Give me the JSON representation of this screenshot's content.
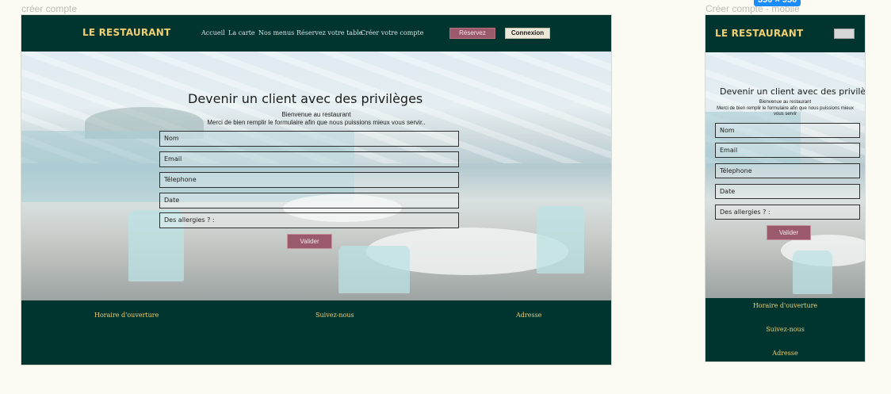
{
  "desktop": {
    "frame_label": "créer compte",
    "brand": "LE RESTAURANT",
    "nav": [
      "Accueil",
      "La carte",
      "Nos menus",
      "Réservez votre table",
      "Créer votre compte"
    ],
    "reserve_label": "Réservez",
    "login_label": "Connexion",
    "title": "Devenir un client avec des privilèges",
    "welcome": "Bienvenue au restaurant",
    "instruction": "Merci de bien remplir le formulaire afin que nous puissions mieux vous servir..",
    "fields": [
      "Nom",
      "Email",
      "Télephone",
      "Date",
      "Des allergies ? :"
    ],
    "submit_label": "Valider",
    "footer": [
      "Horaire d'ouverture",
      "Suivez-nous",
      "Adresse"
    ]
  },
  "mobile": {
    "frame_label": "Créer compte - mobile",
    "size_badge": "390 × 950",
    "brand": "LE RESTAURANT",
    "title": "Devenir un client avec des privilèges",
    "welcome": "Bienvenue au restaurant",
    "instruction": "Merci de bien remplir le formulaire afin que nous puissions mieux vous servir",
    "fields": [
      "Nom",
      "Email",
      "Télephone",
      "Date",
      "Des allergies ? :"
    ],
    "submit_label": "Valider",
    "footer": [
      "Horaire d'ouverture",
      "Suivez-nous",
      "Adresse"
    ]
  },
  "colors": {
    "brand_dark": "#00342f",
    "accent_gold": "#f0cf72",
    "accent_mauve": "#9b5a6c"
  }
}
